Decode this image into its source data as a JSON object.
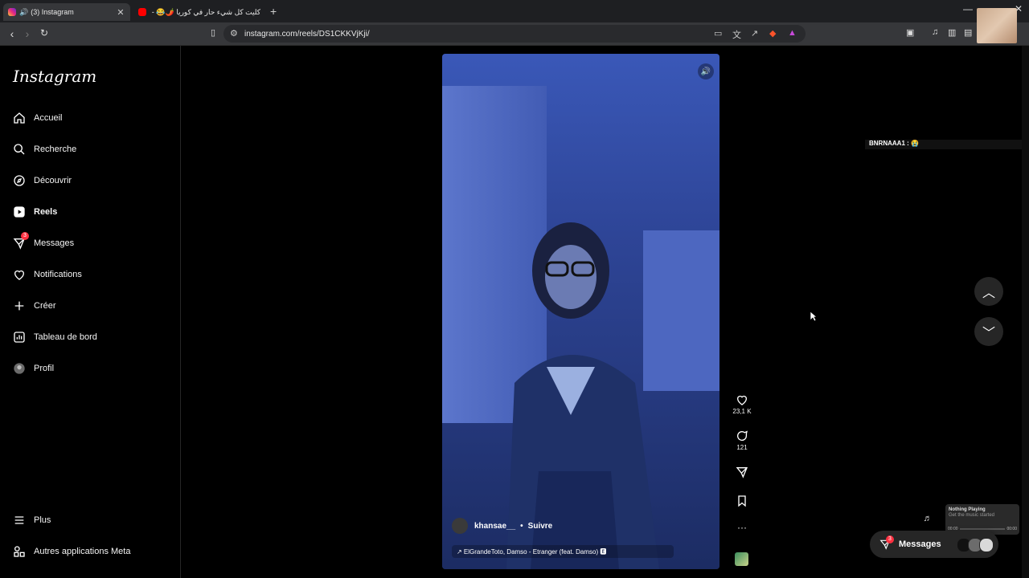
{
  "browser": {
    "tabs": [
      {
        "title": "(3) Instagram",
        "active": true
      },
      {
        "title": "كليت كل شيء حار في كوريا 🌶️😂 - 😋 ce",
        "active": false
      }
    ],
    "url": "instagram.com/reels/DS1CKKVjKji/",
    "new_tab": "+",
    "shield_badge": "3"
  },
  "sidebar": {
    "logo": "Instagram",
    "items": [
      {
        "label": "Accueil",
        "icon": "home-icon"
      },
      {
        "label": "Recherche",
        "icon": "search-icon"
      },
      {
        "label": "Découvrir",
        "icon": "compass-icon"
      },
      {
        "label": "Reels",
        "icon": "reels-icon"
      },
      {
        "label": "Messages",
        "icon": "messenger-icon",
        "badge": "3"
      },
      {
        "label": "Notifications",
        "icon": "heart-icon"
      },
      {
        "label": "Créer",
        "icon": "plus-icon"
      },
      {
        "label": "Tableau de bord",
        "icon": "dashboard-icon"
      },
      {
        "label": "Profil",
        "icon": "profile-avatar"
      }
    ],
    "bottom": [
      {
        "label": "Plus",
        "icon": "menu-icon"
      },
      {
        "label": "Autres applications Meta",
        "icon": "meta-apps-icon"
      }
    ]
  },
  "reel": {
    "username": "khansae__",
    "separator": "•",
    "follow": "Suivre",
    "audio": "↗ ElGrandeToto, Damso - Etranger (feat. Damso) 🅴",
    "likes": "23,1 K",
    "comments": "121"
  },
  "overlay": {
    "chat_line": "BNRNAAA1 : 😭"
  },
  "now_playing": {
    "title": "Nothing Playing",
    "subtitle": "Get the music started",
    "time_start": "00:00",
    "time_end": "00:00"
  },
  "messages_pill": {
    "label": "Messages",
    "badge": "3"
  },
  "colors": {
    "accent_badge": "#ff3040",
    "background": "#000000",
    "sidebar_border": "#262626"
  }
}
